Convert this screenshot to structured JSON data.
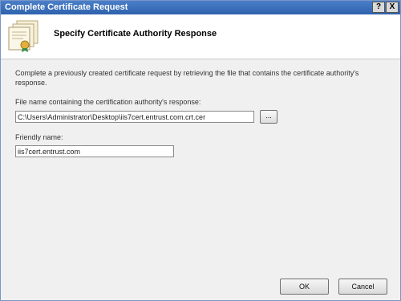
{
  "window": {
    "title": "Complete Certificate Request",
    "help_label": "?",
    "close_label": "X"
  },
  "header": {
    "title": "Specify Certificate Authority Response",
    "icon": "certificate-stack-icon"
  },
  "content": {
    "description": "Complete a previously created certificate request by retrieving the file that contains the certificate authority's response.",
    "file_label": "File name containing the certification authority's response:",
    "file_value": "C:\\Users\\Administrator\\Desktop\\iis7cert.entrust.com.crt.cer",
    "browse_label": "...",
    "friendly_label": "Friendly name:",
    "friendly_value": "iis7cert.entrust.com"
  },
  "footer": {
    "ok_label": "OK",
    "cancel_label": "Cancel"
  }
}
